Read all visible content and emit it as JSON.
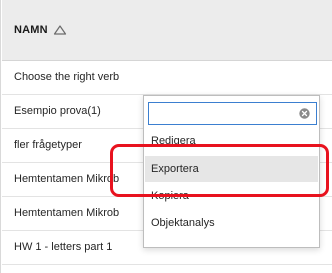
{
  "table": {
    "header": {
      "column_label": "NAMN"
    },
    "rows": [
      {
        "name": "Choose the right verb"
      },
      {
        "name": "Esempio prova(1)"
      },
      {
        "name": "fler frågetyper"
      },
      {
        "name": "Hemtentamen Mikrob"
      },
      {
        "name": "Hemtentamen Mikrob"
      },
      {
        "name": "HW 1 - letters part 1"
      }
    ]
  },
  "dropdown": {
    "search_value": "",
    "items": [
      {
        "label": "Redigera"
      },
      {
        "label": "Exportera",
        "highlighted": true
      },
      {
        "label": "Kopiera"
      },
      {
        "label": "Objektanalys"
      }
    ]
  },
  "colors": {
    "annotation": "#e8121e",
    "search_focus_border": "#3b7fd0",
    "header_bg": "#ececec",
    "highlight_bg": "#e6e6e6"
  },
  "icons": {
    "sort": "triangle-up-outline-icon",
    "clear": "circle-x-icon"
  }
}
